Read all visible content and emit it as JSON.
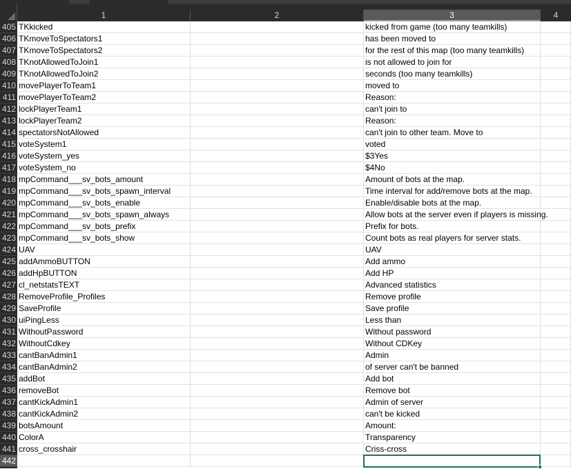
{
  "columns": [
    "1",
    "2",
    "3",
    "4"
  ],
  "selected_column": "3",
  "selected_row": "442",
  "colors": {
    "header_bg": "#2b2b2b",
    "selected_header": "#5a5a5a",
    "selection_border": "#217346",
    "gridline": "#e1e1e1"
  },
  "rows": [
    {
      "num": "405",
      "key": "TKkicked",
      "value": "kicked from game (too many teamkills)"
    },
    {
      "num": "406",
      "key": "TKmoveToSpectators1",
      "value": "has been moved to"
    },
    {
      "num": "407",
      "key": "TKmoveToSpectators2",
      "value": "for the rest of this map (too many teamkills)"
    },
    {
      "num": "408",
      "key": "TKnotAllowedToJoin1",
      "value": "is not allowed to join for"
    },
    {
      "num": "409",
      "key": "TKnotAllowedToJoin2",
      "value": "seconds (too many teamkills)"
    },
    {
      "num": "410",
      "key": "movePlayerToTeam1",
      "value": "moved to"
    },
    {
      "num": "411",
      "key": "movePlayerToTeam2",
      "value": "Reason:"
    },
    {
      "num": "412",
      "key": "lockPlayerTeam1",
      "value": "can't join to"
    },
    {
      "num": "413",
      "key": "lockPlayerTeam2",
      "value": "Reason:"
    },
    {
      "num": "414",
      "key": "spectatorsNotAllowed",
      "value": "can't join to other team. Move to"
    },
    {
      "num": "415",
      "key": "voteSystem1",
      "value": "voted"
    },
    {
      "num": "416",
      "key": "voteSystem_yes",
      "value": "$3Yes"
    },
    {
      "num": "417",
      "key": "voteSystem_no",
      "value": "$4No"
    },
    {
      "num": "418",
      "key": "mpCommand___sv_bots_amount",
      "value": "Amount of bots at the map."
    },
    {
      "num": "419",
      "key": "mpCommand___sv_bots_spawn_interval",
      "value": "Time interval for add/remove bots at the map."
    },
    {
      "num": "420",
      "key": "mpCommand___sv_bots_enable",
      "value": "Enable/disable bots at the map."
    },
    {
      "num": "421",
      "key": "mpCommand___sv_bots_spawn_always",
      "value": "Allow bots at the server even if players is missing."
    },
    {
      "num": "422",
      "key": "mpCommand___sv_bots_prefix",
      "value": "Prefix for bots."
    },
    {
      "num": "423",
      "key": "mpCommand___sv_bots_show",
      "value": "Count bots as real players for server stats."
    },
    {
      "num": "424",
      "key": "UAV",
      "value": "UAV"
    },
    {
      "num": "425",
      "key": "addAmmoBUTTON",
      "value": "Add ammo"
    },
    {
      "num": "426",
      "key": "addHpBUTTON",
      "value": "Add HP"
    },
    {
      "num": "427",
      "key": "cl_netstatsTEXT",
      "value": "Advanced statistics"
    },
    {
      "num": "428",
      "key": "RemoveProfile_Profiles",
      "value": "Remove profile"
    },
    {
      "num": "429",
      "key": "SaveProfile",
      "value": "Save profile"
    },
    {
      "num": "430",
      "key": "uiPingLess",
      "value": "Less than"
    },
    {
      "num": "431",
      "key": "WithoutPassword",
      "value": "Without password"
    },
    {
      "num": "432",
      "key": "WithoutCdkey",
      "value": "Without CDKey"
    },
    {
      "num": "433",
      "key": "cantBanAdmin1",
      "value": "Admin"
    },
    {
      "num": "434",
      "key": "cantBanAdmin2",
      "value": "of server can't be banned"
    },
    {
      "num": "435",
      "key": "addBot",
      "value": "Add bot"
    },
    {
      "num": "436",
      "key": "removeBot",
      "value": "Remove bot"
    },
    {
      "num": "437",
      "key": "cantKickAdmin1",
      "value": "Admin of server"
    },
    {
      "num": "438",
      "key": "cantKickAdmin2",
      "value": "can't be kicked"
    },
    {
      "num": "439",
      "key": "botsAmount",
      "value": "Amount:"
    },
    {
      "num": "440",
      "key": "ColorA",
      "value": "Transparency"
    },
    {
      "num": "441",
      "key": "cross_crosshair",
      "value": "Criss-cross"
    },
    {
      "num": "442",
      "key": "",
      "value": ""
    }
  ]
}
